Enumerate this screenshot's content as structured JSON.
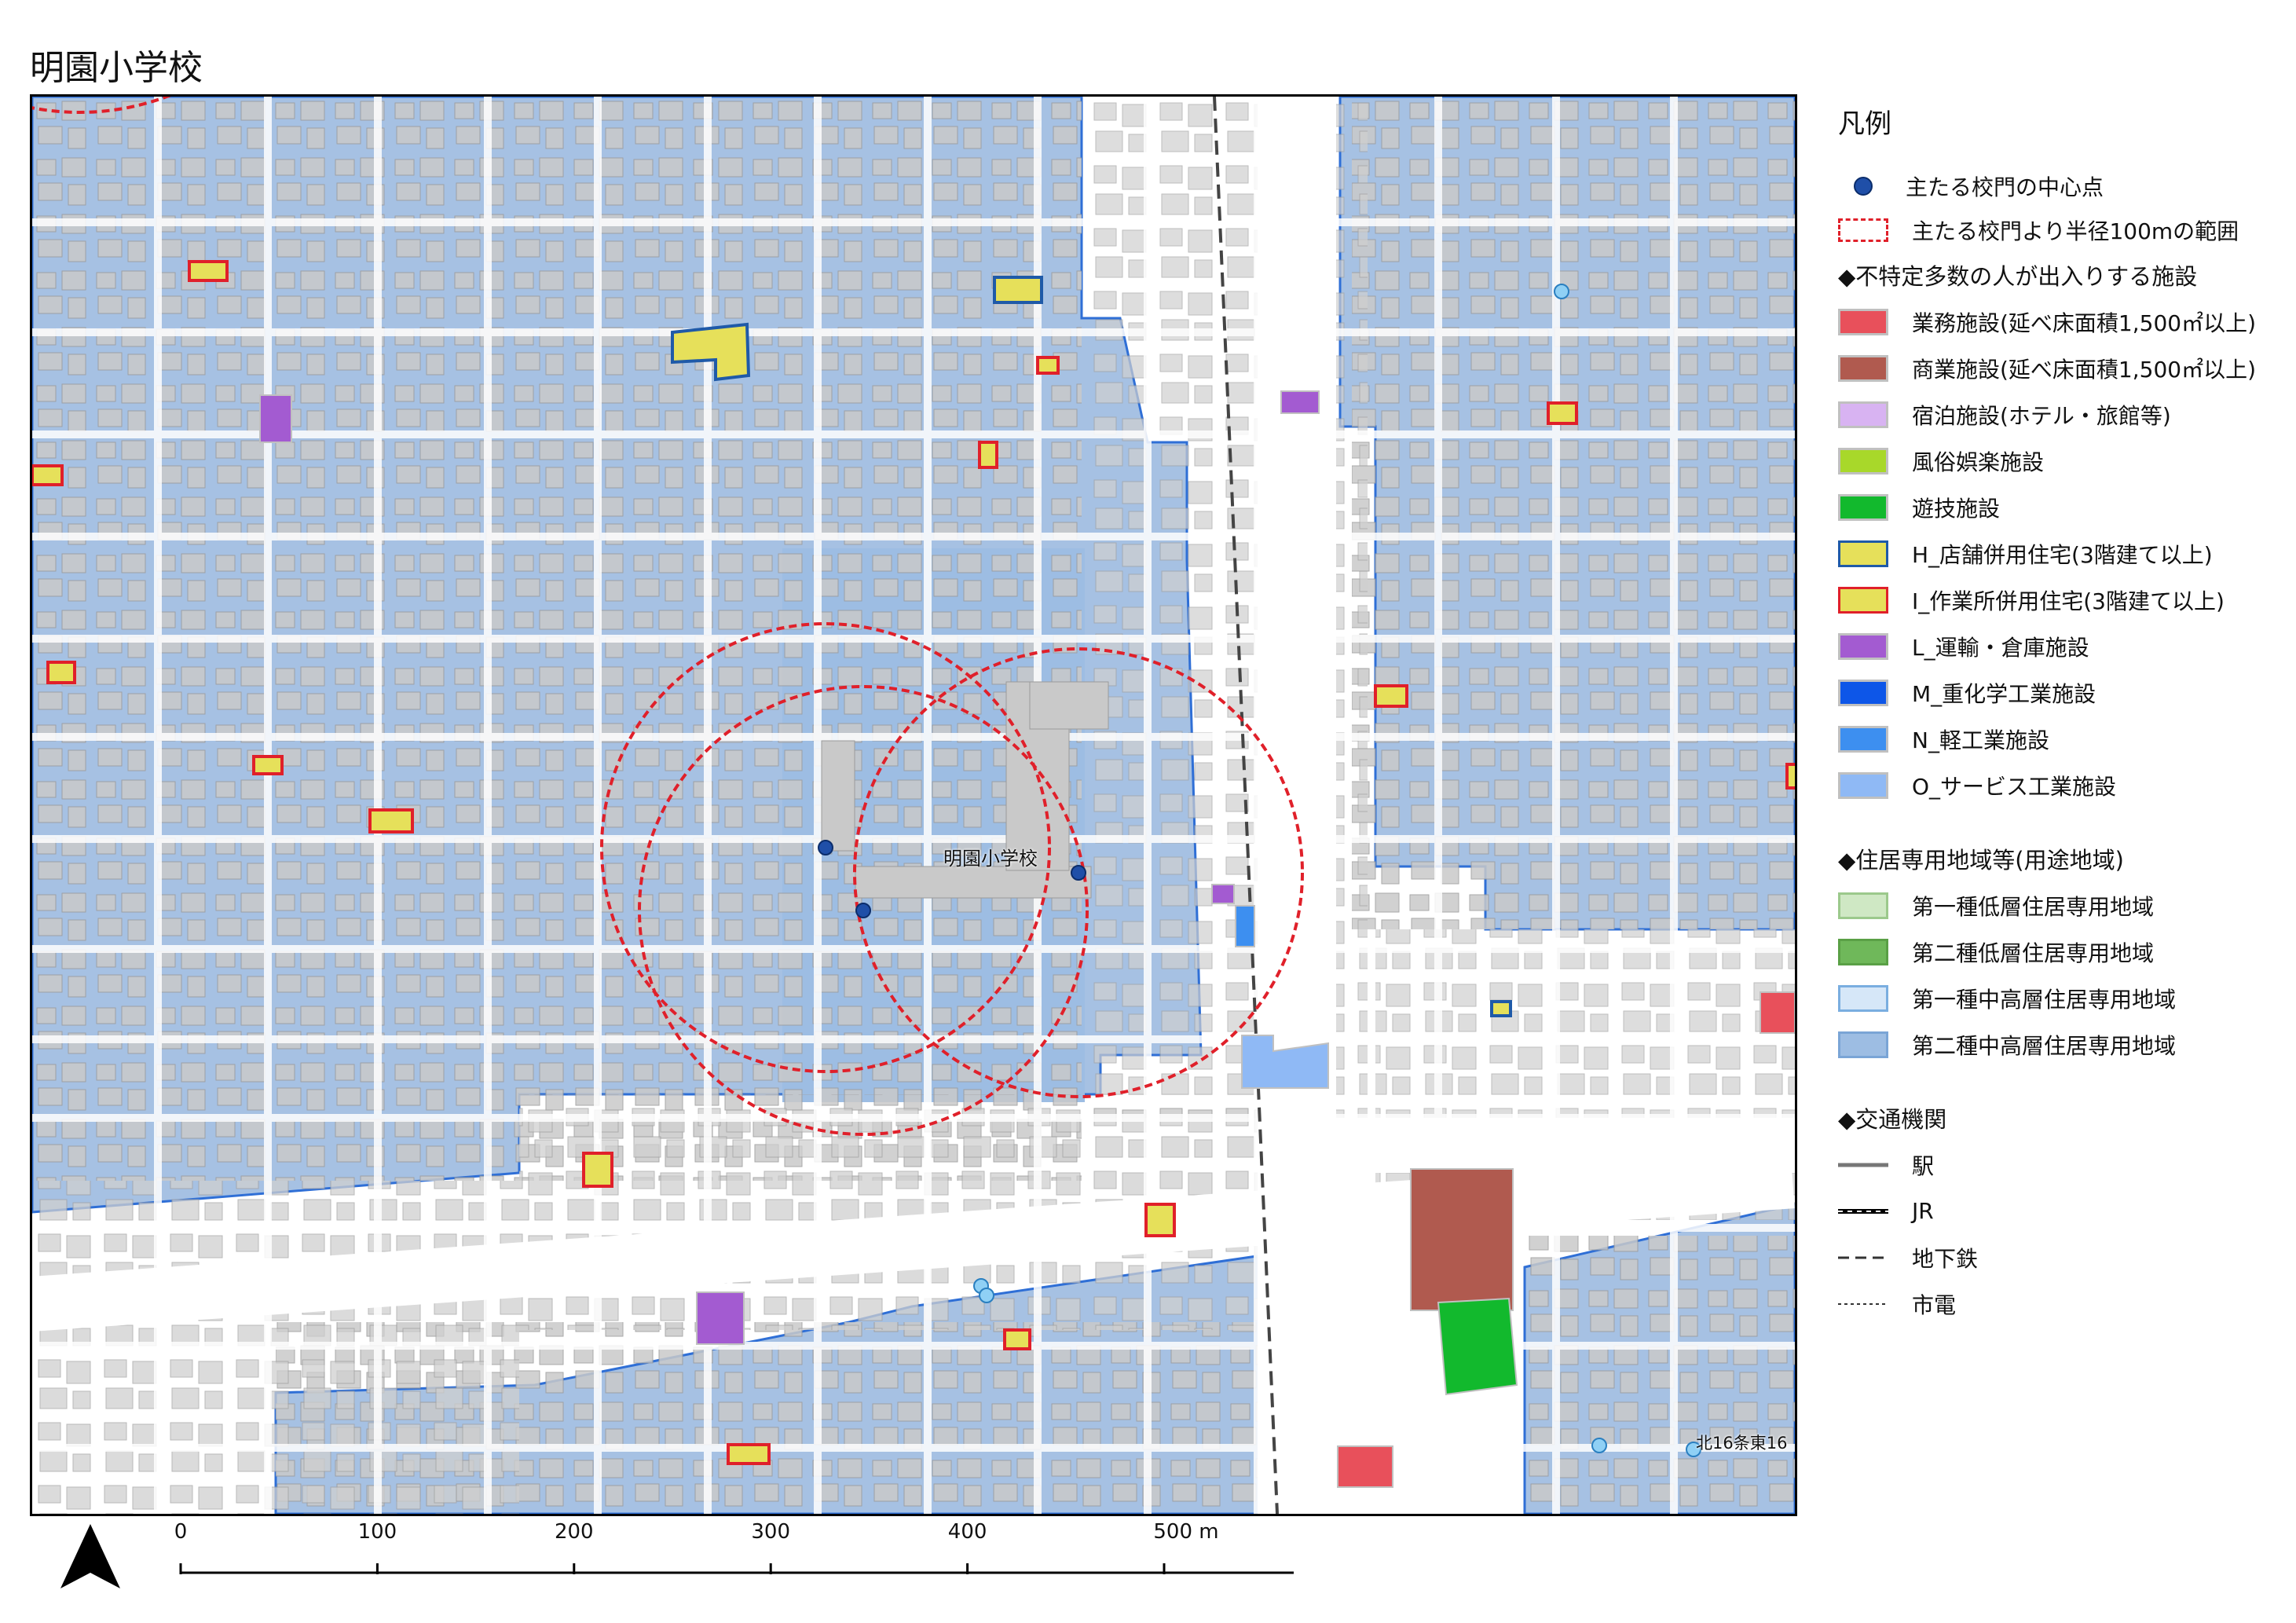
{
  "title": "明園小学校",
  "map": {
    "school_label": "明園小学校",
    "place_label": "北16条東16",
    "colors": {
      "residential_zone": "#a6c1e3",
      "building": "#c9c9c9",
      "road": "#ffffff",
      "zone_border": "#2f6fd6",
      "circle": "#e0202a"
    }
  },
  "legend": {
    "title": "凡例",
    "gate_point": "主たる校門の中心点",
    "radius_range": "主たる校門より半径100mの範囲",
    "section_facilities": "◆不特定多数の人が出入りする施設",
    "facilities": [
      {
        "label": "業務施設(延べ床面積1,500㎡以上)",
        "fill": "#e8505b",
        "border": "#c0c0c0"
      },
      {
        "label": "商業施設(延べ床面積1,500㎡以上)",
        "fill": "#b05a4f",
        "border": "#c0c0c0"
      },
      {
        "label": "宿泊施設(ホテル・旅館等)",
        "fill": "#d8b3f2",
        "border": "#c0c0c0"
      },
      {
        "label": "風俗娯楽施設",
        "fill": "#a8d82a",
        "border": "#c0c0c0"
      },
      {
        "label": "遊技施設",
        "fill": "#12b92d",
        "border": "#c0c0c0"
      },
      {
        "label": "H_店舗併用住宅(3階建て以上)",
        "fill": "#e6e05a",
        "border": "#1f5aa8"
      },
      {
        "label": "I_作業所併用住宅(3階建て以上)",
        "fill": "#e6e05a",
        "border": "#e0202a"
      },
      {
        "label": "L_運輸・倉庫施設",
        "fill": "#a35bd1",
        "border": "#c0c0c0"
      },
      {
        "label": "M_重化学工業施設",
        "fill": "#0d56e8",
        "border": "#c0c0c0"
      },
      {
        "label": "N_軽工業施設",
        "fill": "#3d8ff0",
        "border": "#c0c0c0"
      },
      {
        "label": "O_サービス工業施設",
        "fill": "#8fb9f5",
        "border": "#c0c0c0"
      }
    ],
    "section_zones": "◆住居専用地域等(用途地域)",
    "zones": [
      {
        "label": "第一種低層住居専用地域",
        "fill": "#cfe8c4",
        "border": "#9cc98c"
      },
      {
        "label": "第二種低層住居専用地域",
        "fill": "#6fb85a",
        "border": "#5aa046"
      },
      {
        "label": "第一種中高層住居専用地域",
        "fill": "#d6e7f8",
        "border": "#7aaee0"
      },
      {
        "label": "第二種中高層住居専用地域",
        "fill": "#9dbde3",
        "border": "#7aa5d6"
      }
    ],
    "section_transport": "◆交通機関",
    "transport": [
      {
        "label": "駅",
        "style": "station"
      },
      {
        "label": "JR",
        "style": "jr"
      },
      {
        "label": "地下鉄",
        "style": "subway"
      },
      {
        "label": "市電",
        "style": "tram"
      }
    ]
  },
  "scale": {
    "ticks": [
      "0",
      "100",
      "200",
      "300",
      "400",
      "500 m"
    ]
  }
}
